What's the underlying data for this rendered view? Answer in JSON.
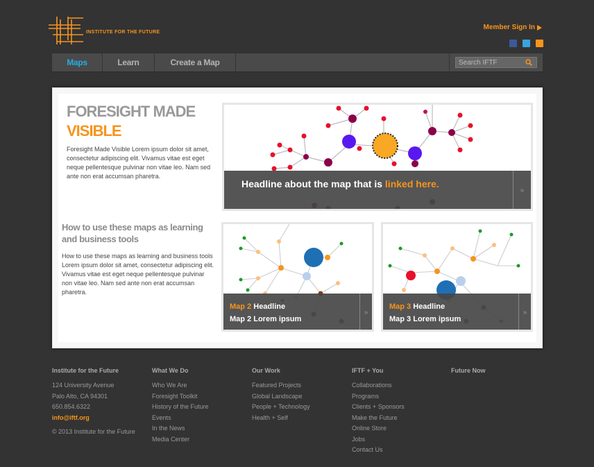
{
  "header": {
    "logo_text": "INSTITUTE FOR THE FUTURE",
    "member_signin": "Member Sign In",
    "social_icons": [
      "facebook-icon",
      "twitter-icon",
      "rss-icon"
    ]
  },
  "nav": {
    "items": [
      {
        "label": "Maps",
        "active": true
      },
      {
        "label": "Learn",
        "active": false
      },
      {
        "label": "Create a Map",
        "active": false
      }
    ],
    "search_placeholder": "Search IFTF"
  },
  "intro": {
    "title_line1": "FORESIGHT MADE",
    "title_line2": "VISIBLE",
    "body": "Foresight Made Visible Lorem ipsum dolor sit amet, consectetur adipiscing elit. Vivamus vitae est eget neque pellentesque pulvinar non vitae leo. Nam sed ante non erat accumsan pharetra."
  },
  "howto": {
    "title": "How to use these maps as learning and business tools",
    "body": "How to use these maps as learning and business tools Lorem ipsum dolor sit amet, consectetur adipiscing elit. Vivamus vitae est eget neque pellentesque pulvinar non vitae leo. Nam sed ante non erat accumsan pharetra."
  },
  "featured": {
    "headline_part1": "Headline about the map that is ",
    "headline_link": "linked here."
  },
  "maps": [
    {
      "label": "Map 2",
      "headline": " Headline",
      "subline": "Map 2 Lorem ipsum"
    },
    {
      "label": "Map 3",
      "headline": " Headline",
      "subline": "Map 3 Lorem ipsum"
    }
  ],
  "colors": {
    "accent": "#f7941d",
    "nav_active": "#29abe2",
    "background": "#333333"
  },
  "footer": {
    "col1": {
      "heading": "Institute for the Future",
      "address1": "124 University Avenue",
      "address2": "Palo Alto, CA 94301",
      "phone": "650.854.6322",
      "email": "info@iftf.org",
      "copyright": "© 2013 Institute for the Future"
    },
    "col2": {
      "heading": "What We Do",
      "links": [
        "Who We Are",
        "Foresight Toolkit",
        "History of the Future",
        "Events",
        "In the News",
        "Media Center"
      ]
    },
    "col3": {
      "heading": "Our Work",
      "links": [
        "Featured Projects",
        "Global Landscape",
        "People + Technology",
        "Health + Self"
      ]
    },
    "col4": {
      "heading": "IFTF + You",
      "links": [
        "Collaborations",
        "Programs",
        "Clients + Sponsors",
        "Make the Future",
        "Online Store",
        "Jobs",
        "Contact Us"
      ]
    },
    "col5": {
      "heading": "Future Now"
    }
  }
}
